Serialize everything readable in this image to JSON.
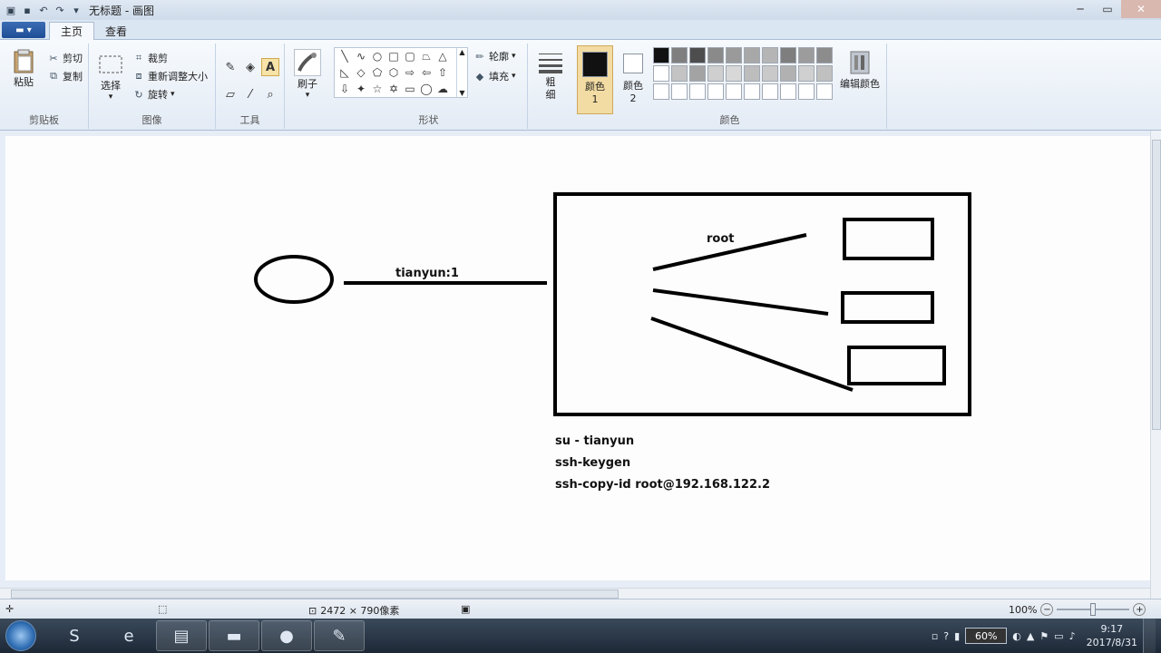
{
  "window": {
    "title": "无标题 - 画图",
    "qa_icons": [
      "app-icon",
      "save-icon",
      "undo-icon",
      "redo-icon",
      "customize-icon"
    ]
  },
  "tabs": {
    "file_menu": "▬ ▾",
    "home": "主页",
    "view": "查看"
  },
  "ribbon": {
    "clipboard": {
      "paste": "粘贴",
      "cut": "剪切",
      "copy": "复制",
      "label": "剪贴板"
    },
    "image": {
      "select": "选择",
      "crop": "裁剪",
      "resize": "重新调整大小",
      "rotate": "旋转",
      "label": "图像"
    },
    "tools": {
      "label": "工具"
    },
    "brushes": {
      "label": "刷子"
    },
    "shapes": {
      "outline": "轮廓",
      "fill": "填充",
      "label": "形状"
    },
    "size": {
      "label": "粗细"
    },
    "colors": {
      "color1": "颜色 1",
      "color2": "颜色 2",
      "edit": "编辑颜色",
      "label": "颜色",
      "color1_value": "#111111",
      "color2_value": "#ffffff",
      "palette": [
        "#111111",
        "#7f7f7f",
        "#4d4d4d",
        "#8a8a8a",
        "#9a9a9a",
        "#a8a8a8",
        "#b5b5b5",
        "#7e7e7e",
        "#9c9c9c",
        "#8c8c8c",
        "#ffffff",
        "#c3c3c3",
        "#a3a3a3",
        "#cfcfcf",
        "#d8d8d8",
        "#bdbdbd",
        "#c9c9c9",
        "#b1b1b1",
        "#d0d0d0",
        "#c0c0c0",
        "#ffffff",
        "#ffffff",
        "#ffffff",
        "#ffffff",
        "#ffffff",
        "#ffffff",
        "#ffffff",
        "#ffffff",
        "#ffffff",
        "#ffffff"
      ]
    }
  },
  "drawing": {
    "client_label": "tianyun:1",
    "root_label": "root",
    "commands": [
      "su - tianyun",
      "ssh-keygen",
      "ssh-copy-id root@192.168.122.2"
    ]
  },
  "status": {
    "size": "2472 × 790像素",
    "zoom": "100%"
  },
  "taskbar": {
    "battery": "60%",
    "time": "9:17",
    "date": "2017/8/31"
  }
}
